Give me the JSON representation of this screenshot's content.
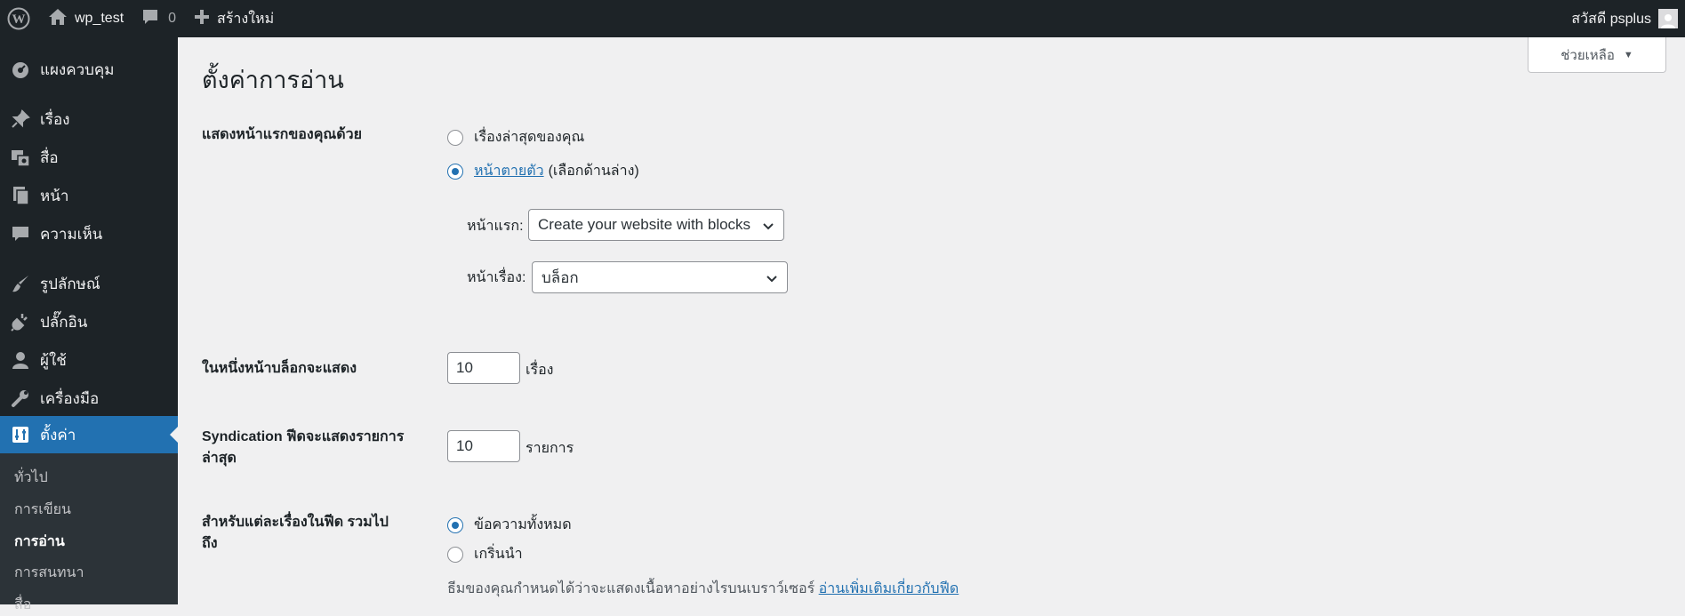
{
  "adminbar": {
    "site_name": "wp_test",
    "comments_count": "0",
    "new_label": "สร้างใหม่",
    "greeting": "สวัสดี psplus"
  },
  "sidebar": {
    "items": [
      {
        "label": "แผงควบคุม",
        "icon": "dashboard-icon"
      },
      {
        "label": "เรื่อง",
        "icon": "pin-icon"
      },
      {
        "label": "สื่อ",
        "icon": "media-icon"
      },
      {
        "label": "หน้า",
        "icon": "page-icon"
      },
      {
        "label": "ความเห็น",
        "icon": "comment-icon"
      },
      {
        "label": "รูปลักษณ์",
        "icon": "brush-icon"
      },
      {
        "label": "ปลั๊กอิน",
        "icon": "plugin-icon"
      },
      {
        "label": "ผู้ใช้",
        "icon": "user-icon"
      },
      {
        "label": "เครื่องมือ",
        "icon": "wrench-icon"
      },
      {
        "label": "ตั้งค่า",
        "icon": "settings-icon"
      }
    ],
    "submenu": [
      "ทั่วไป",
      "การเขียน",
      "การอ่าน",
      "การสนทนา",
      "สื่อ"
    ]
  },
  "main": {
    "help_label": "ช่วยเหลือ",
    "page_title": "ตั้งค่าการอ่าน",
    "front_page": {
      "label": "แสดงหน้าแรกของคุณด้วย",
      "option_latest": "เรื่องล่าสุดของคุณ",
      "option_static_link": "หน้าตายตัว",
      "option_static_suffix": "(เลือกด้านล่าง)",
      "homepage_label": "หน้าแรก:",
      "homepage_value": "Create your website with blocks",
      "postspage_label": "หน้าเรื่อง:",
      "postspage_value": "บล็อก"
    },
    "posts_per_page": {
      "label": "ในหนึ่งหน้าบล็อกจะแสดง",
      "value": "10",
      "unit": "เรื่อง"
    },
    "syndication": {
      "label_line1": "Syndication ฟีดจะแสดงรายการ",
      "label_line2": "ล่าสุด",
      "value": "10",
      "unit": "รายการ"
    },
    "feed_content": {
      "label_line1": "สำหรับแต่ละเรื่องในฟีด รวมไป",
      "label_line2": "ถึง",
      "option_full": "ข้อความทั้งหมด",
      "option_excerpt": "เกริ่นนำ",
      "note": "ธีมของคุณกำหนดได้ว่าจะแสดงเนื้อหาอย่างไรบนเบราว์เซอร์",
      "note_link": "อ่านเพิ่มเติมเกี่ยวกับฟีด"
    }
  },
  "colors": {
    "accent": "#2271b1",
    "adminbar": "#1d2327",
    "submenu": "#2c3338",
    "background": "#f0f0f1"
  }
}
